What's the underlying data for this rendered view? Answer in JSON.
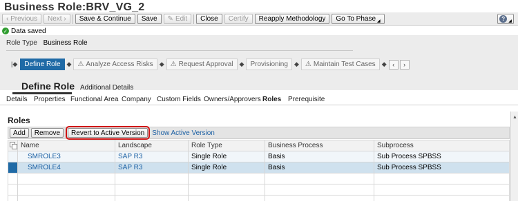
{
  "window": {
    "title": "Business Role:BRV_VG_2"
  },
  "toolbar": {
    "previous": "‹ Previous",
    "next": "Next ›",
    "save_continue": "Save & Continue",
    "save": "Save",
    "edit": "Edit",
    "close": "Close",
    "certify": "Certify",
    "reapply": "Reapply Methodology",
    "goto_phase": "Go To Phase",
    "help": "?"
  },
  "message": {
    "text": "Data saved",
    "status_color": "#2e9c2e"
  },
  "header": {
    "role_type_label": "Role Type",
    "role_type_value": "Business Role"
  },
  "roadmap": {
    "steps": [
      {
        "label": "Define Role",
        "active": true
      },
      {
        "label": "Analyze Access Risks",
        "active": false
      },
      {
        "label": "Request Approval",
        "active": false
      },
      {
        "label": "Provisioning",
        "active": false
      },
      {
        "label": "Maintain Test Cases",
        "active": false
      }
    ],
    "prev_label": "‹",
    "next_label": "›"
  },
  "page_tabs": {
    "main": "Define Role",
    "other": "Additional Details"
  },
  "subtabs": [
    {
      "label": "Details"
    },
    {
      "label": "Properties"
    },
    {
      "label": "Functional Area"
    },
    {
      "label": "Company"
    },
    {
      "label": "Custom Fields"
    },
    {
      "label": "Owners/Approvers"
    },
    {
      "label": "Roles",
      "selected": true
    },
    {
      "label": "Prerequisite"
    }
  ],
  "roles_panel": {
    "title": "Roles",
    "buttons": {
      "add": "Add",
      "remove": "Remove",
      "revert": "Revert to Active Version"
    },
    "show_active_link": "Show Active Version",
    "columns": [
      "Name",
      "Landscape",
      "Role Type",
      "Business Process",
      "Subprocess"
    ],
    "rows": [
      {
        "name": "SMROLE3",
        "landscape": "SAP R3",
        "role_type": "Single Role",
        "business_process": "Basis",
        "subprocess": "Sub Process SPBSS"
      },
      {
        "name": "SMROLE4",
        "landscape": "SAP R3",
        "role_type": "Single Role",
        "business_process": "Basis",
        "subprocess": "Sub Process SPBSS"
      }
    ]
  },
  "colors": {
    "accent": "#1f6aa6",
    "highlight_border": "#d01414",
    "link": "#1a5fa3"
  }
}
